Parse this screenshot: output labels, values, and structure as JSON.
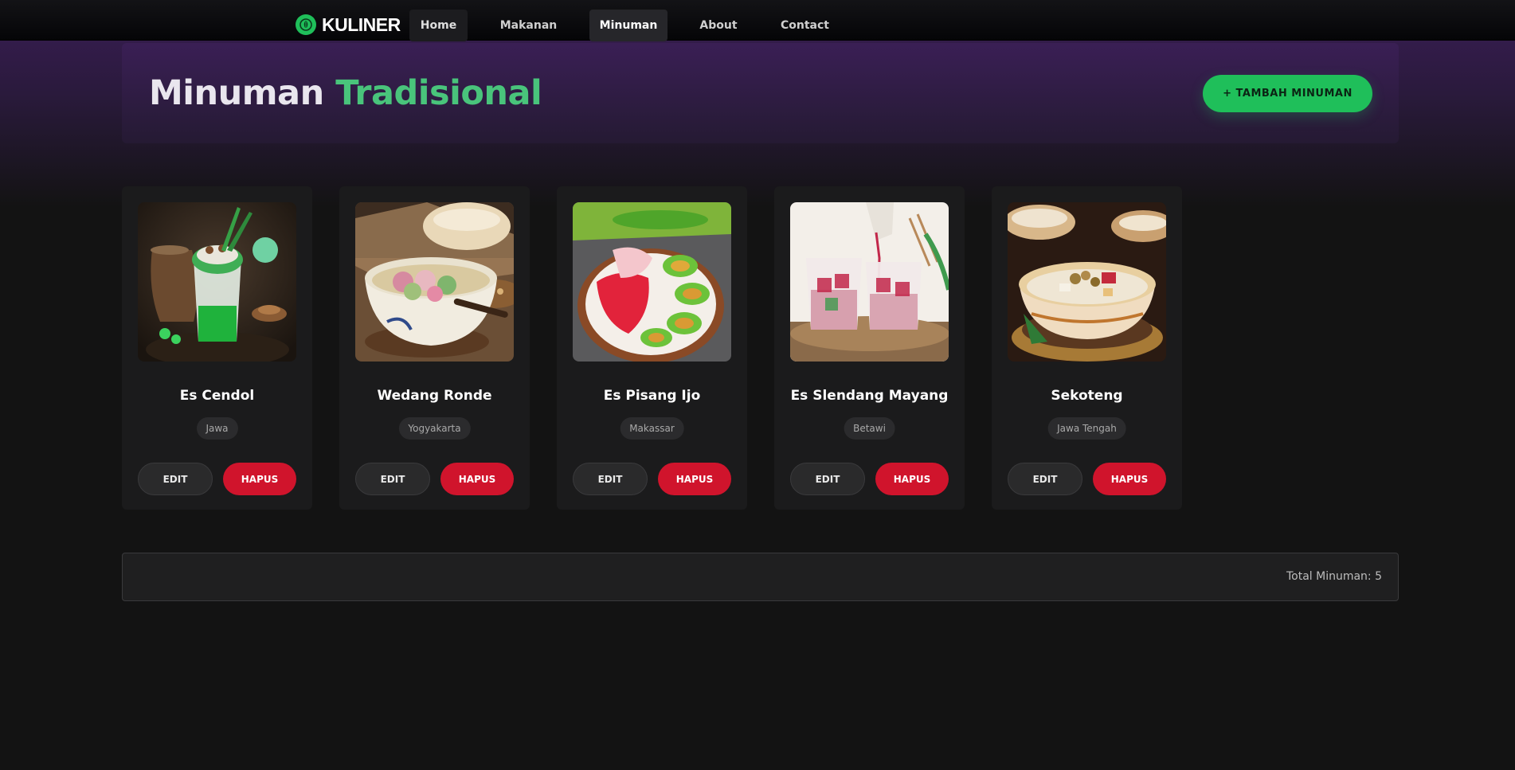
{
  "brand": {
    "name": "KULINER",
    "logo_icon": "leaf-icon",
    "accent": "#1fbf5a"
  },
  "nav": {
    "items": [
      {
        "label": "Home"
      },
      {
        "label": "Makanan"
      },
      {
        "label": "Minuman",
        "active": true
      },
      {
        "label": "About"
      },
      {
        "label": "Contact"
      }
    ]
  },
  "header": {
    "title_part1": "Minuman",
    "title_part2": "Tradisional",
    "add_button": "+ TAMBAH MINUMAN"
  },
  "cards": [
    {
      "name": "Es Cendol",
      "region": "Jawa",
      "edit": "EDIT",
      "delete": "HAPUS"
    },
    {
      "name": "Wedang Ronde",
      "region": "Yogyakarta",
      "edit": "EDIT",
      "delete": "HAPUS"
    },
    {
      "name": "Es Pisang Ijo",
      "region": "Makassar",
      "edit": "EDIT",
      "delete": "HAPUS"
    },
    {
      "name": "Es Slendang Mayang",
      "region": "Betawi",
      "edit": "EDIT",
      "delete": "HAPUS"
    },
    {
      "name": "Sekoteng",
      "region": "Jawa Tengah",
      "edit": "EDIT",
      "delete": "HAPUS"
    }
  ],
  "footer": {
    "total": "Total Minuman: 5"
  },
  "colors": {
    "danger": "#d0142c",
    "success": "#1fbf5a",
    "title_accent": "#49c47b"
  }
}
